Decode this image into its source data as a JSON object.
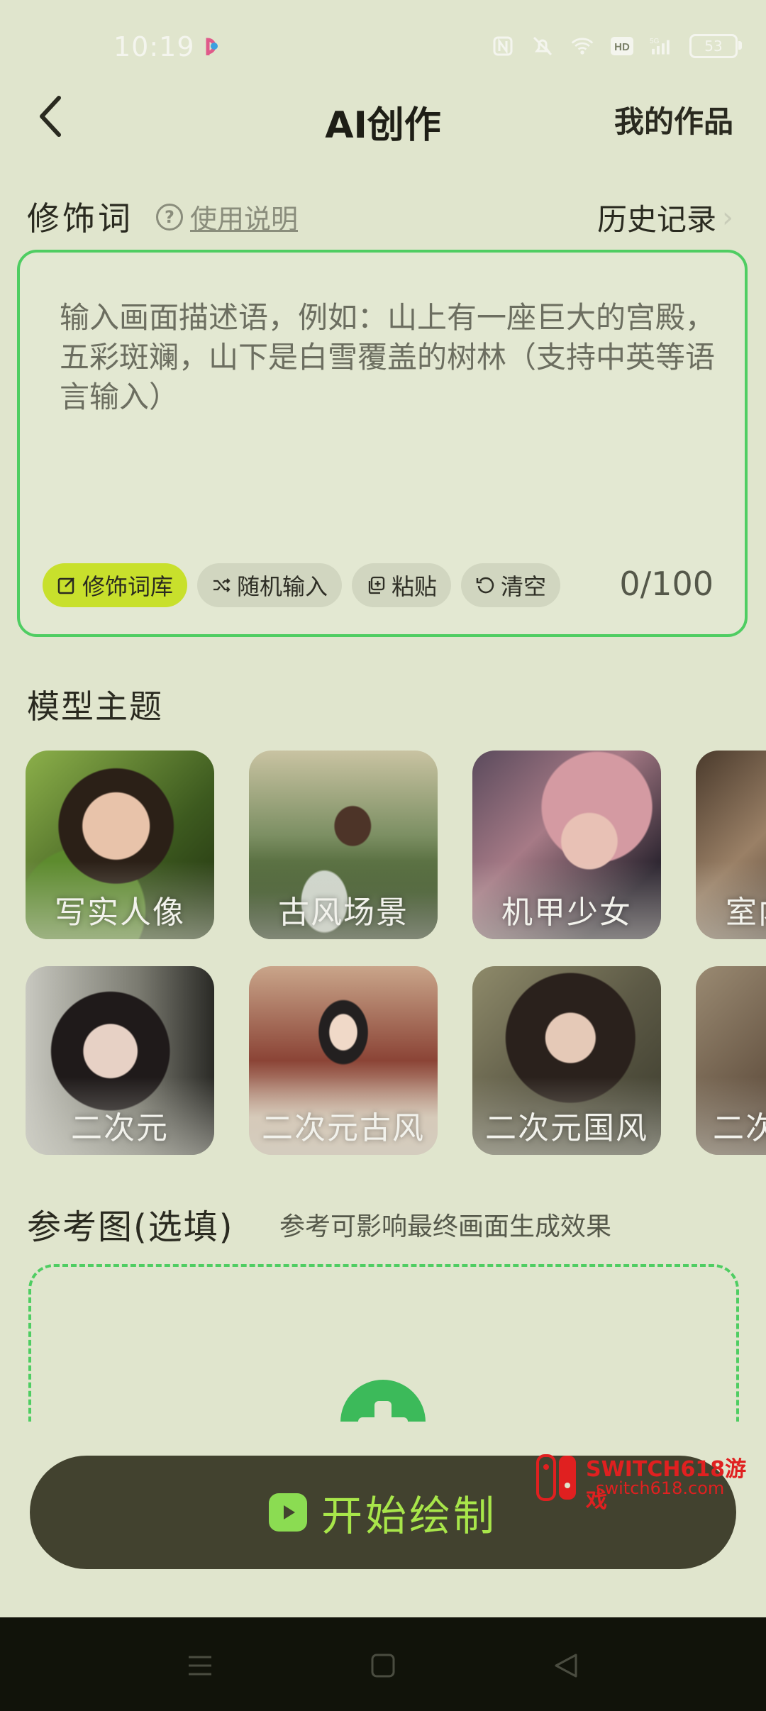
{
  "status_bar": {
    "time": "10:19",
    "battery": "53",
    "network": "5G",
    "hd": "HD"
  },
  "header": {
    "title": "AI创作",
    "right_action": "我的作品"
  },
  "modifiers": {
    "label": "修饰词",
    "help_link": "使用说明",
    "history": "历史记录",
    "placeholder": "输入画面描述语，例如：山上有一座巨大的宫殿，五彩斑斓，山下是白雪覆盖的树林（支持中英等语言输入）",
    "chips": [
      "修饰词库",
      "随机输入",
      "粘贴",
      "清空"
    ],
    "counter": "0/100"
  },
  "model_theme": {
    "title": "模型主题",
    "items": [
      "写实人像",
      "古风场景",
      "机甲少女",
      "室内",
      "二次元",
      "二次元古风",
      "二次元国风",
      "二次"
    ]
  },
  "reference": {
    "title": "参考图(选填)",
    "hint": "参考可影响最终画面生成效果"
  },
  "start_button": {
    "label": "开始绘制"
  },
  "watermark": {
    "title": "SWITCH618游戏",
    "url": "switch618.com"
  },
  "colors": {
    "accent_green": "#4fcd62",
    "chip_highlight": "#c8e02c",
    "button_bg": "#42422f",
    "button_text": "#a8e64a"
  }
}
